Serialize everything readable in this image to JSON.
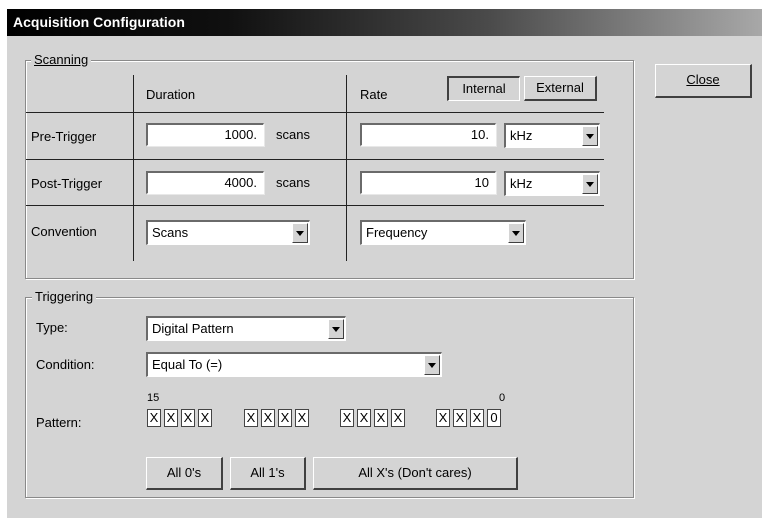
{
  "window": {
    "title": "Acquisition Configuration"
  },
  "close_button": "Close",
  "scanning": {
    "legend": "Scanning",
    "duration_header": "Duration",
    "rate_header": "Rate",
    "internal_button": "Internal",
    "external_button": "External",
    "rows": {
      "pre_trigger": {
        "label": "Pre-Trigger",
        "duration": "1000.",
        "duration_unit": "scans",
        "rate": "10.",
        "rate_unit": "kHz"
      },
      "post_trigger": {
        "label": "Post-Trigger",
        "duration": "4000.",
        "duration_unit": "scans",
        "rate": "10",
        "rate_unit": "kHz"
      },
      "convention": {
        "label": "Convention",
        "duration_value": "Scans",
        "rate_value": "Frequency"
      }
    }
  },
  "triggering": {
    "legend": "Triggering",
    "type_label": "Type:",
    "type_value": "Digital Pattern",
    "condition_label": "Condition:",
    "condition_value": "Equal To (=)",
    "pattern_label": "Pattern:",
    "bit_high_label": "15",
    "bit_low_label": "0",
    "pattern_bits": [
      "X",
      "X",
      "X",
      "X",
      "X",
      "X",
      "X",
      "X",
      "X",
      "X",
      "X",
      "X",
      "X",
      "X",
      "X",
      "0"
    ],
    "buttons": {
      "all_zeros": "All 0's",
      "all_ones": "All 1's",
      "all_x": "All X's (Don't cares)"
    }
  }
}
